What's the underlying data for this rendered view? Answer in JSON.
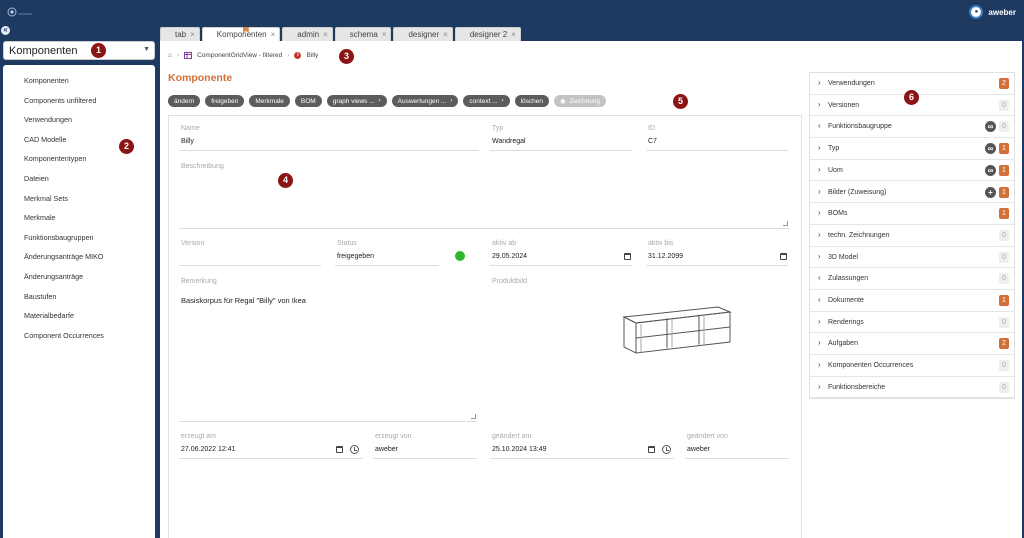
{
  "header": {
    "user": "aweber",
    "user_icon": "user-avatar-icon",
    "brand": "#1f3a61"
  },
  "module": {
    "selected": "Komponenten"
  },
  "sidebar": {
    "items": [
      {
        "label": "Komponenten"
      },
      {
        "label": "Components unfiltered"
      },
      {
        "label": "Verwendungen"
      },
      {
        "label": "CAD Modelle"
      },
      {
        "label": "Komponententypen"
      },
      {
        "label": "Dateien"
      },
      {
        "label": "Merkmal Sets"
      },
      {
        "label": "Merkmale"
      },
      {
        "label": "Funktionsbaugruppen"
      },
      {
        "label": "Änderungsanträge MIKO"
      },
      {
        "label": "Änderungsanträge"
      },
      {
        "label": "Baustufen"
      },
      {
        "label": "Materialbedarfe"
      },
      {
        "label": "Component Occurrences"
      }
    ]
  },
  "tabs": [
    {
      "label": "tab"
    },
    {
      "label": "Komponenten"
    },
    {
      "label": "admin"
    },
    {
      "label": "schema"
    },
    {
      "label": "designer"
    },
    {
      "label": "designer 2"
    }
  ],
  "breadcrumb": {
    "view": "ComponentGridView - filtered",
    "item": "Billy"
  },
  "page": {
    "title": "Komponente"
  },
  "actions": [
    {
      "label": "ändern"
    },
    {
      "label": "freigeben"
    },
    {
      "label": "Merkmale"
    },
    {
      "label": "BOM"
    },
    {
      "label": "graph views ...",
      "has_arrow": true
    },
    {
      "label": "Auswertungen ...",
      "has_arrow": true
    },
    {
      "label": "context ...",
      "has_arrow": true
    },
    {
      "label": "löschen"
    },
    {
      "label": "Zeichnung",
      "disabled": true
    }
  ],
  "form": {
    "name_label": "Name",
    "name": "Billy",
    "typ_label": "Typ",
    "typ": "Wandregal",
    "id_label": "ID",
    "id": "C7",
    "desc_label": "Beschreibung",
    "desc": "",
    "version_label": "Version",
    "version": "",
    "status_label": "Status",
    "status": "freigegeben",
    "status_color": "#2eb82e",
    "aktiv_ab_label": "aktiv ab",
    "aktiv_ab": "29.05.2024",
    "aktiv_bis_label": "aktiv bis",
    "aktiv_bis": "31.12.2099",
    "bemerkung_label": "Bemerkung",
    "bemerkung": "Basiskorpus für Regal \"Billy\" von Ikea",
    "produktbild_label": "Produktbild",
    "erzeugt_am_label": "erzeugt am",
    "erzeugt_am": "27.06.2022 12:41",
    "erzeugt_von_label": "erzeugt von",
    "erzeugt_von": "aweber",
    "geaendert_am_label": "geändert am",
    "geaendert_am": "25.10.2024 13:49",
    "geaendert_von_label": "geändert von",
    "geaendert_von": "aweber"
  },
  "relations": [
    {
      "label": "Verwendungen",
      "count": "2",
      "open": false,
      "icon": null
    },
    {
      "label": "Versionen",
      "count": "0",
      "open": false,
      "icon": null
    },
    {
      "label": "Funktionsbaugruppe",
      "count": "0",
      "open": true,
      "icon": "link-icon"
    },
    {
      "label": "Typ",
      "count": "1",
      "open": false,
      "icon": "link-icon"
    },
    {
      "label": "Uom",
      "count": "1",
      "open": false,
      "icon": "link-icon"
    },
    {
      "label": "Bilder (Zuweisung)",
      "count": "1",
      "open": false,
      "icon": "add-icon"
    },
    {
      "label": "BOMs",
      "count": "1",
      "open": false,
      "icon": null
    },
    {
      "label": "techn. Zeichnungen",
      "count": "0",
      "open": false,
      "icon": null
    },
    {
      "label": "3D Model",
      "count": "0",
      "open": false,
      "icon": null
    },
    {
      "label": "Zulassungen",
      "count": "0",
      "open": true,
      "icon": null
    },
    {
      "label": "Dokumente",
      "count": "1",
      "open": true,
      "icon": null
    },
    {
      "label": "Renderings",
      "count": "0",
      "open": false,
      "icon": null
    },
    {
      "label": "Aufgaben",
      "count": "2",
      "open": false,
      "icon": null
    },
    {
      "label": "Komponenten Occurrences",
      "count": "0",
      "open": false,
      "icon": null
    },
    {
      "label": "Funktionsbereiche",
      "count": "0",
      "open": false,
      "icon": null
    }
  ],
  "markers": [
    "1",
    "2",
    "3",
    "4",
    "5",
    "6"
  ]
}
